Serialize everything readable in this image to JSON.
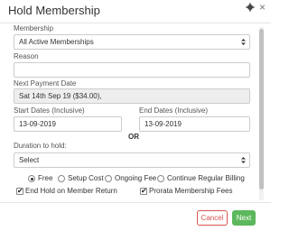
{
  "modal": {
    "title": "Hold Membership",
    "gear_icon": "gear-icon",
    "close_icon": "close-icon",
    "close_glyph": "×"
  },
  "form": {
    "membership_label": "Membership",
    "membership_value": "All Active Memberships",
    "reason_label": "Reason",
    "reason_value": "",
    "next_payment_label": "Next Payment Date",
    "next_payment_value": "Sat 14th Sep 19  ($34.00),",
    "start_dates_label": "Start Dates (Inclusive)",
    "start_dates_value": "13-09-2019",
    "end_dates_label": "End Dates (Inclusive)",
    "end_dates_value": "13-09-2019",
    "or_label": "OR",
    "duration_label": "Duration to hold:",
    "duration_value": "Select",
    "fee_options": [
      {
        "label": "Free",
        "checked": true
      },
      {
        "label": "Setup Cost",
        "checked": false
      },
      {
        "label": "Ongoing Fee",
        "checked": false
      },
      {
        "label": "Continue Regular Billing",
        "checked": false
      }
    ],
    "end_hold_label": "End Hold on Member Return",
    "end_hold_checked": true,
    "prorata_label": "Prorata Membership Fees",
    "prorata_checked": true
  },
  "footer": {
    "cancel_label": "Cancel",
    "next_label": "Next"
  },
  "colors": {
    "cancel": "#d9534f",
    "next": "#5cb85c"
  }
}
